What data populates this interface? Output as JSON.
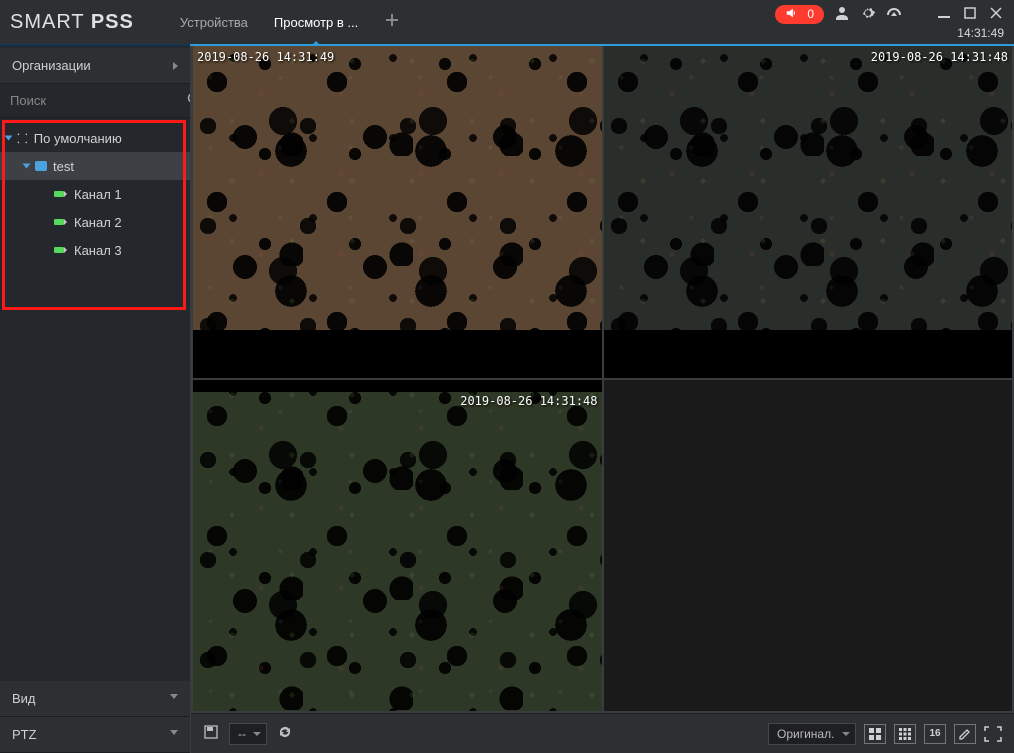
{
  "header": {
    "logo_a": "SMART",
    "logo_b": "PSS",
    "tabs": [
      {
        "label": "Устройства",
        "active": false
      },
      {
        "label": "Просмотр в ...",
        "active": true
      }
    ],
    "alert_count": "0",
    "clock": "14:31:49"
  },
  "sidebar": {
    "panel_org": "Организации",
    "search_placeholder": "Поиск",
    "tree": {
      "root": "По умолчанию",
      "device": "test",
      "channels": [
        "Канал 1",
        "Канал 2",
        "Канал 3"
      ]
    },
    "panel_view": "Вид",
    "panel_ptz": "PTZ"
  },
  "grid": {
    "ts1": "2019-08-26 14:31:49",
    "ts2": "2019-08-26 14:31:48",
    "ts3": "2019-08-26 14:31:48"
  },
  "footer": {
    "select_value": "--",
    "scale_label": "Оригинал.",
    "layout_16": "16"
  }
}
